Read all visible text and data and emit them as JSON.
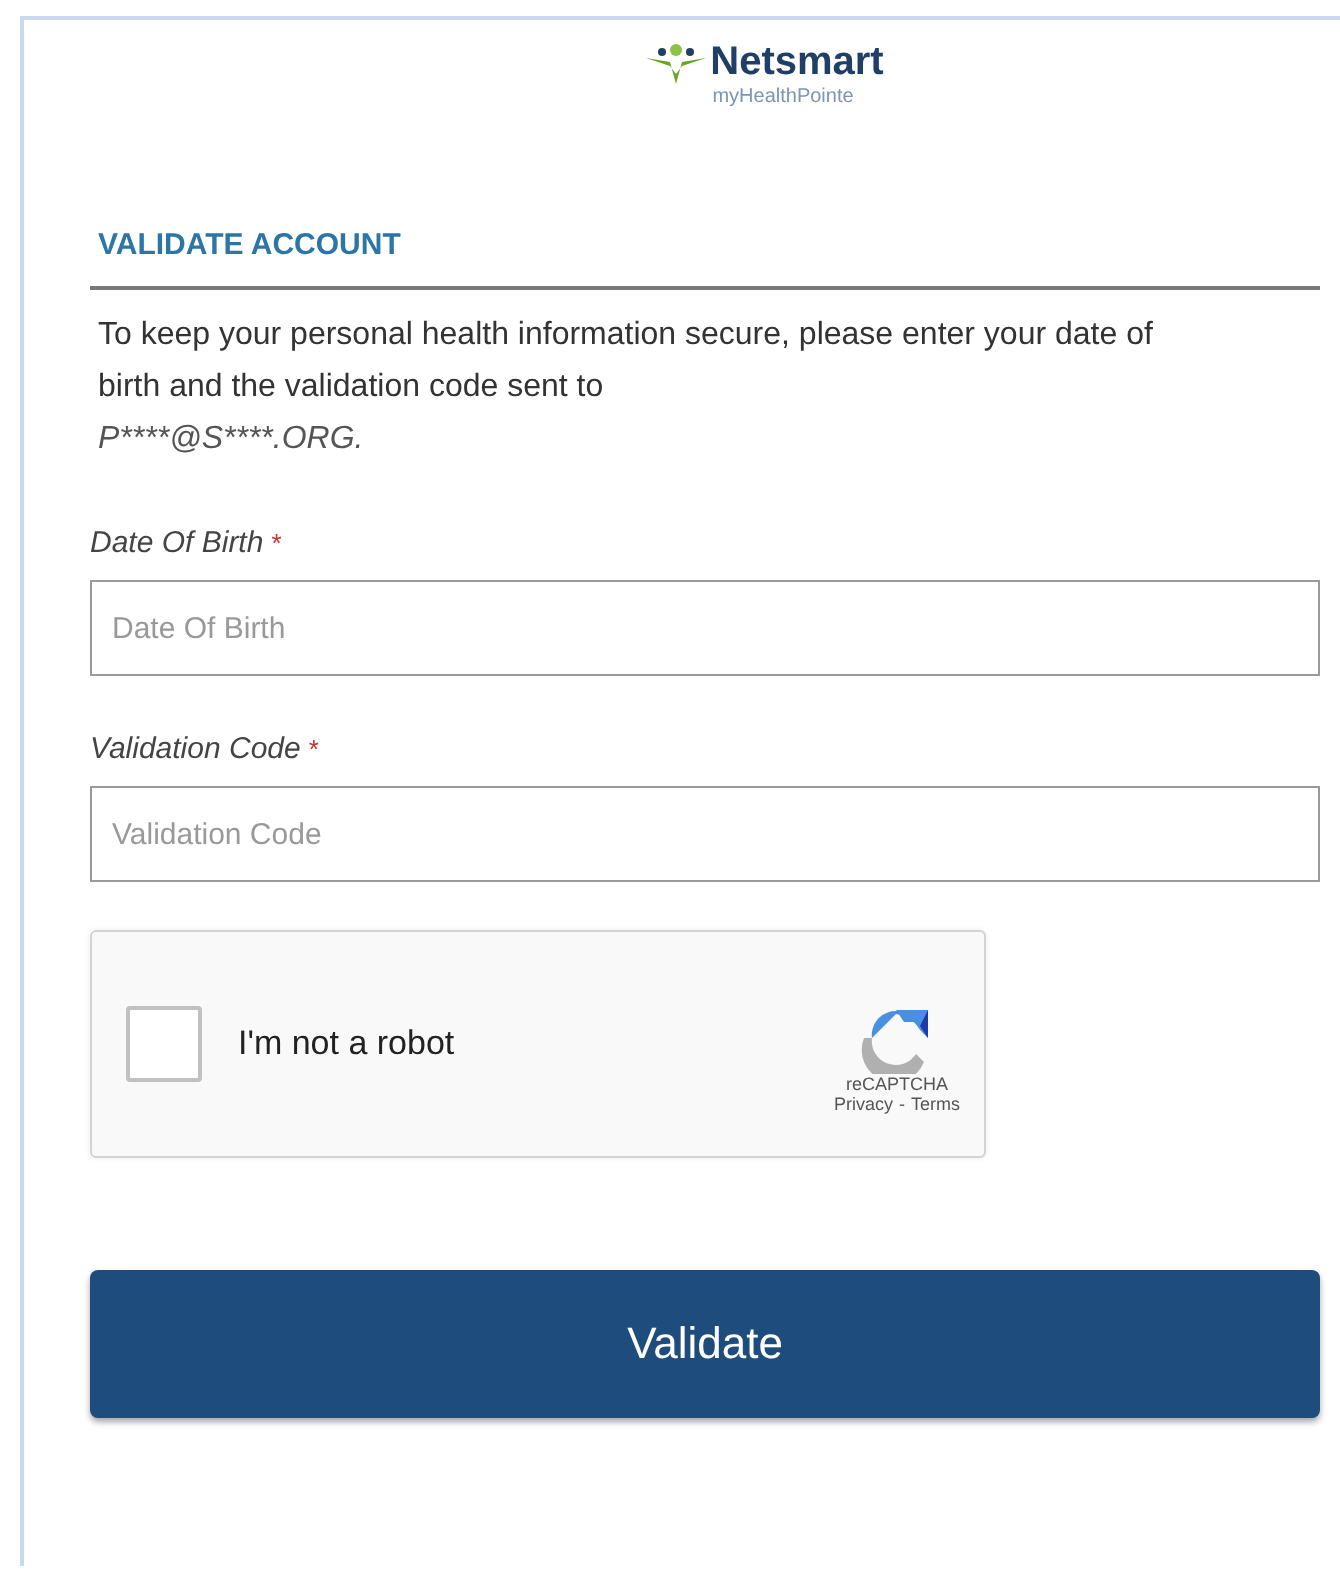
{
  "logo": {
    "brand": "Netsmart",
    "product": "myHealthPointe"
  },
  "heading": "VALIDATE ACCOUNT",
  "intro": "To keep your personal health information secure, please enter your date of birth and the validation code sent to",
  "masked_email": "P****@S****.ORG.",
  "fields": [
    {
      "label": "Date Of Birth",
      "required_mark": "*",
      "placeholder": "Date Of Birth"
    },
    {
      "label": "Validation Code",
      "required_mark": "*",
      "placeholder": "Validation Code"
    }
  ],
  "captcha": {
    "label": "I'm not a robot",
    "checked": false,
    "brand": "reCAPTCHA",
    "privacy_link": "Privacy",
    "separator": "-",
    "terms_link": "Terms"
  },
  "button": "Validate"
}
